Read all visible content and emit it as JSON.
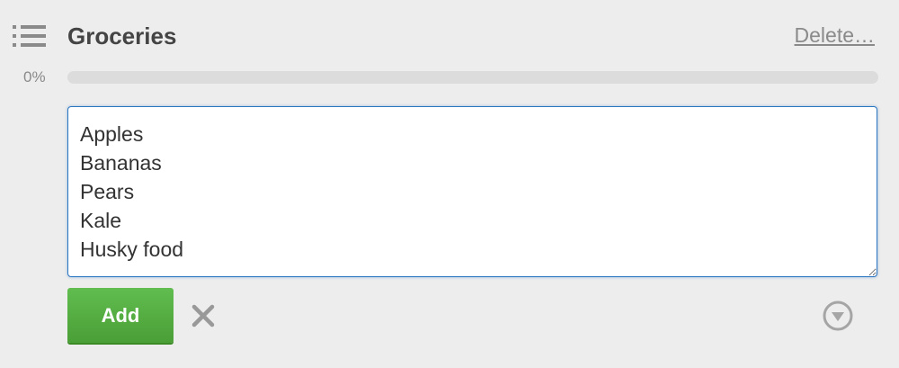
{
  "checklist": {
    "icon": "checklist-icon",
    "title": "Groceries",
    "delete_label": "Delete…",
    "progress_text": "0%",
    "progress_fraction": 0.0,
    "progress_color": "#5aac44"
  },
  "composer": {
    "item_text": "Apples\nBananas\nPears\nKale\nHusky food",
    "focus_color": "#2b76c0",
    "add_label": "Add",
    "add_color": "#4a9f36",
    "cancel_icon": "close-icon",
    "options_icon": "chevron-down-circle-icon"
  }
}
